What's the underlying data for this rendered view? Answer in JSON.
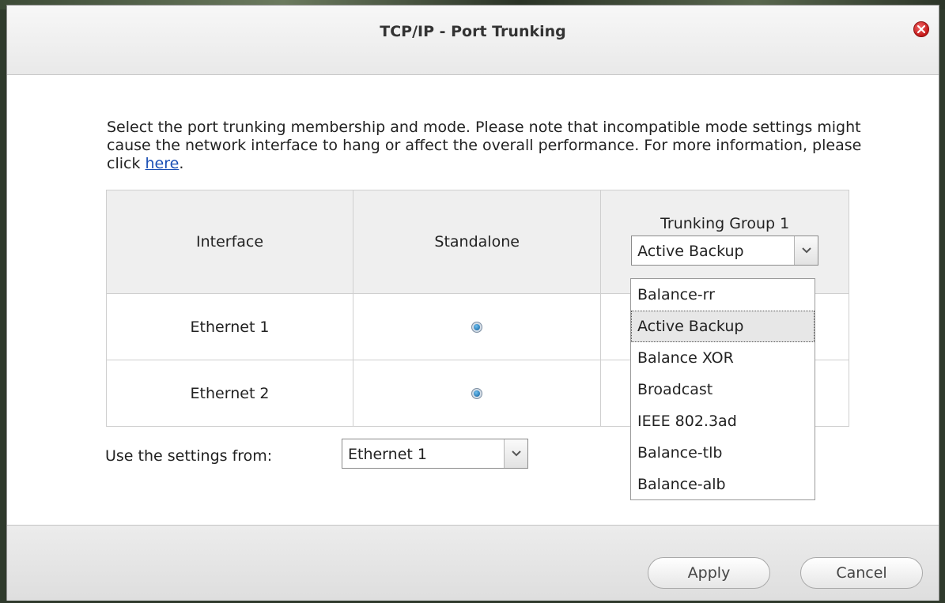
{
  "dialog": {
    "title": "TCP/IP - Port Trunking",
    "description": "Select the port trunking membership and mode. Please note that incompatible mode settings might cause the network interface to hang or affect the overall performance. For more information, please click ",
    "link_text": "here",
    "description_end": "."
  },
  "table": {
    "headers": [
      "Interface",
      "Standalone",
      "Trunking Group 1"
    ],
    "mode_selected": "Active Backup",
    "rows": [
      {
        "interface": "Ethernet 1",
        "standalone": true
      },
      {
        "interface": "Ethernet 2",
        "standalone": true
      }
    ]
  },
  "mode_dropdown": {
    "options": [
      "Balance-rr",
      "Active Backup",
      "Balance XOR",
      "Broadcast",
      "IEEE 802.3ad",
      "Balance-tlb",
      "Balance-alb"
    ],
    "highlighted_index": 1
  },
  "settings_from": {
    "label": "Use the settings from:",
    "value": "Ethernet 1"
  },
  "footer": {
    "apply_label": "Apply",
    "cancel_label": "Cancel"
  },
  "icons": {
    "close": "close-icon",
    "dropdown_arrow": "chevron-down-icon",
    "radio": "radio-selected-icon"
  },
  "colors": {
    "close": "#c41818",
    "link": "#1a4fb5",
    "radio": "#0d5c9a"
  }
}
